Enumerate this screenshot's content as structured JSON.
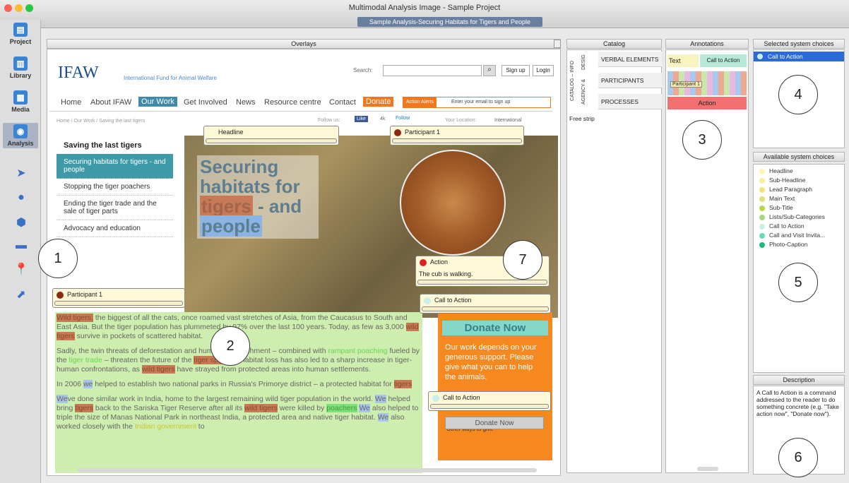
{
  "window": {
    "title": "Multimodal Analysis Image - Sample Project",
    "subtitle": "Sample Analysis-Securing Habitats for Tigers and People"
  },
  "toolbar": {
    "project": "Project",
    "library": "Library",
    "media": "Media",
    "analysis": "Analysis"
  },
  "overlays": {
    "header": "Overlays",
    "site": {
      "logo": "IFAW",
      "logo_sub": "International Fund for Animal Welfare",
      "search_label": "Search:",
      "signup": "Sign up",
      "login": "Login",
      "nav": [
        "Home",
        "About IFAW",
        "Our Work",
        "Get Involved",
        "News",
        "Resource centre",
        "Contact",
        "Donate"
      ],
      "alerts_label": "Action Alerts",
      "alerts_placeholder": "Enter your email to sign up",
      "breadcrumb": "Home / Our Work / Saving the last tigers",
      "follow": "Follow us:",
      "like": "Like",
      "like_count": "4k",
      "follow_btn": "Follow",
      "location": "Your Location:",
      "international": "International",
      "side_title": "Saving the last tigers",
      "side_items": [
        "Securing habitats for tigers - and people",
        "Stopping the tiger poachers",
        "Ending the tiger trade and the sale of tiger parts",
        "Advocacy and education"
      ],
      "hero_line1": "Securing",
      "hero_line2": "habitats for",
      "hero_line3a": "tigers",
      "hero_line3b": " - and",
      "hero_line4": "people",
      "donate_head": "Donate Now",
      "donate_text": "Our work depends on your generous support. Please give what you can to help the animals.",
      "donate_btn": "Donate Now",
      "other_ways": "Other ways to give",
      "para1": "the biggest of all the cats, once roamed vast stretches of Asia, from the Caucasus to South and East Asia. But the tiger population has plummeted by 97% over the last 100 years. Today, as few as 3,000",
      "para1_wild": "Wild tigers,",
      "para1_wild2": "wild tigers",
      "para1_end": "survive in pockets of scattered habitat.",
      "para2a": "Sadly, the twin threats of deforestation and human encroachment – combined with",
      "para2_rampant": "rampant poaching",
      "para2b": "fueled by the",
      "para2_trade": "tiger trade",
      "para2c": "– threaten the future of the",
      "para2_species": "tiger species",
      "para2d": ". Habitat loss has also led to a sharp increase in tiger-human confrontations, as",
      "para2_wild": "wild tigers",
      "para2e": "have strayed from protected areas into human settlements.",
      "para3a": "In 2006",
      "para3_we": "we",
      "para3b": "helped to establish two national parks in Russia's Primorye district – a protected habitat for",
      "para3_tigers": "tigers",
      "para4a": "ve done similar work in India, home to the largest remaining wild tiger population in the world.",
      "para4_we": "We",
      "para4b": "helped bring",
      "para4_tigers": "tigers",
      "para4c": "back to the Sariska Tiger Reserve after all its",
      "para4_wild": "wild tigers",
      "para4d": "were killed by",
      "para4_poachers": "poachers",
      "para4e": "also helped to triple the size of Manas National Park in northeast India, a protected area and native tiger habitat.",
      "para4f": "also worked closely with the",
      "para4_govt": "Indian government",
      "para4g": "to"
    },
    "tags": {
      "headline": "Headline",
      "participant_top": "Participant 1",
      "participant_left": "Participant 1",
      "action": "Action",
      "action_text": "The cub is walking.",
      "cta1": "Call to Action",
      "cta2": "Call to Action"
    }
  },
  "catalog": {
    "header": "Catalog",
    "vtabs": [
      "CATALOG – INFO",
      "DESIG",
      "AGENCY &"
    ],
    "rows": [
      "VERBAL ELEMENTS",
      "PARTICIPANTS",
      "PROCESSES"
    ],
    "free_strip": "Free strip"
  },
  "annotations": {
    "header": "Annotations",
    "text_label": "Text",
    "cta_label": "Call to Action",
    "participant": "Participant 1",
    "action": "Action"
  },
  "selected": {
    "header": "Selected system choices",
    "items": [
      "Call to Action"
    ]
  },
  "available": {
    "header": "Available system choices",
    "items": [
      {
        "label": "Headline",
        "color": "#fff6b0"
      },
      {
        "label": "Sub-Headline",
        "color": "#f8f0a0"
      },
      {
        "label": "Lead Paragraph",
        "color": "#f0e678"
      },
      {
        "label": "Main Text",
        "color": "#e0e07a"
      },
      {
        "label": "Sub-Title",
        "color": "#b8d84a"
      },
      {
        "label": "Lists/Sub-Categories",
        "color": "#a6d880"
      },
      {
        "label": "Call to Action",
        "color": "#c8f0e8"
      },
      {
        "label": "Call and Visit Invita...",
        "color": "#6ad8b8"
      },
      {
        "label": "Photo-Caption",
        "color": "#1fb87a"
      }
    ]
  },
  "description": {
    "header": "Description",
    "text": "A Call to Action is a command addressed to the reader to do something concrete (e.g. \"Take action now\", \"Donate now\")."
  },
  "callouts": [
    "1",
    "2",
    "3",
    "4",
    "5",
    "6",
    "7"
  ]
}
